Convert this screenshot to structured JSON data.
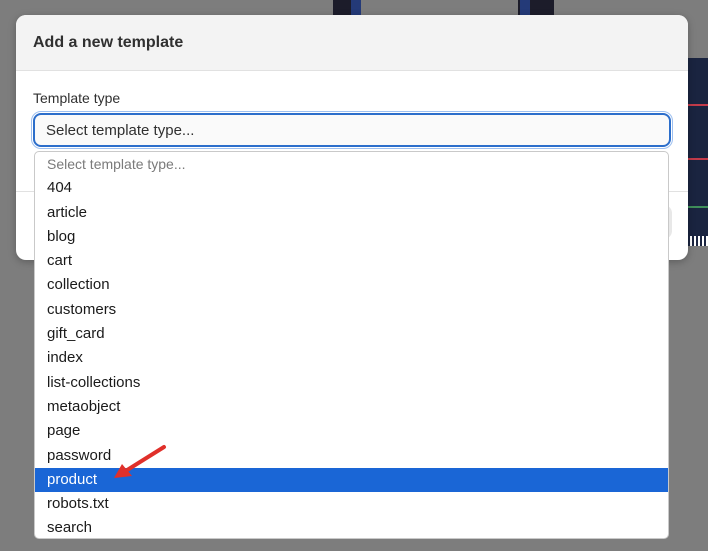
{
  "dialog": {
    "title": "Add a new template",
    "field_label": "Template type",
    "select_value": "Select template type..."
  },
  "dropdown": {
    "options": [
      "Select template type...",
      "404",
      "article",
      "blog",
      "cart",
      "collection",
      "customers",
      "gift_card",
      "index",
      "list-collections",
      "metaobject",
      "page",
      "password",
      "product",
      "robots.txt",
      "search"
    ],
    "highlighted": "product"
  },
  "colors": {
    "highlight": "#1a66d6",
    "focus_border": "#2c6ecb",
    "arrow": "#e0302a"
  }
}
